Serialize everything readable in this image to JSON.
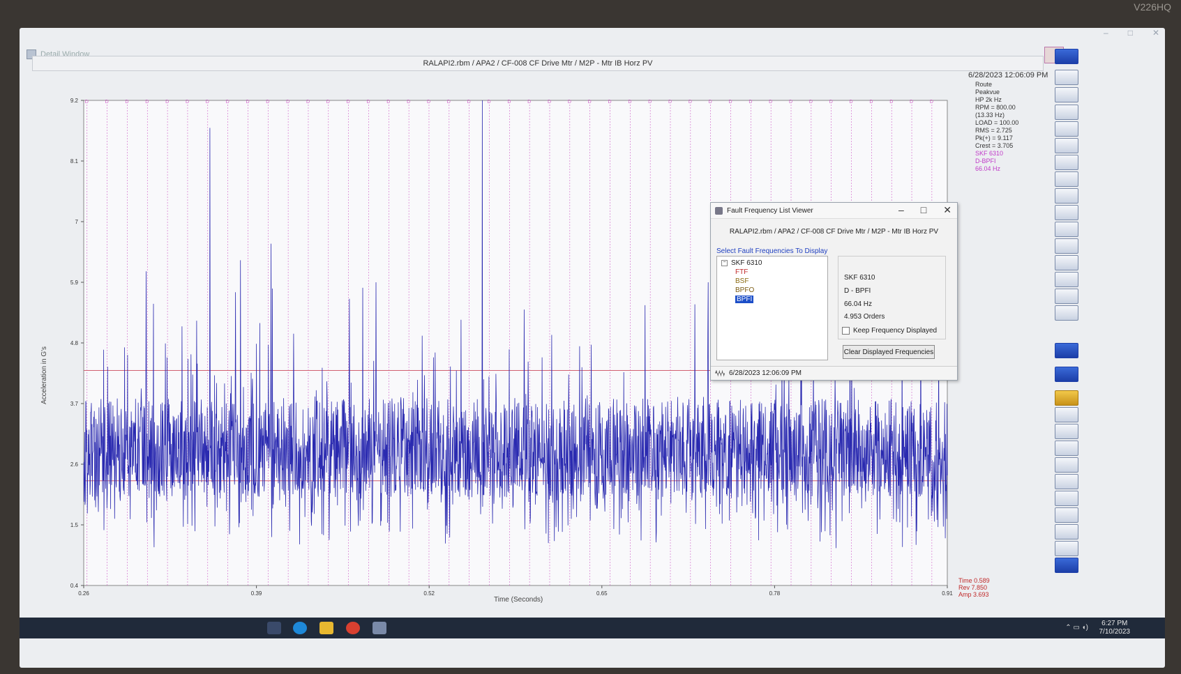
{
  "monitor_label": "V226HQ",
  "window": {
    "title": "Detail Window",
    "path": "RALAPI2.rbm / APA2 / CF-008 CF Drive Mtr / M2P - Mtr IB Horz PV",
    "datetime": "6/28/2023 12:06:09 PM"
  },
  "info": [
    "Route",
    "Peakvue",
    "HP 2k Hz",
    "RPM = 800.00",
    "(13.33 Hz)",
    "LOAD = 100.00",
    "RMS = 2.725",
    "Pk(+) = 9.117",
    "Crest = 3.705"
  ],
  "info_fault": [
    "SKF 6310",
    "D-BPFI",
    "66.04 Hz"
  ],
  "readout": [
    "Time 0.589",
    "Rev 7.850",
    "Amp 3.693"
  ],
  "chart_data": {
    "type": "line",
    "xlabel": "Time (Seconds)",
    "ylabel": "Acceleration in G's",
    "xlim": [
      0.26,
      0.91
    ],
    "ylim": [
      0.4,
      9.2
    ],
    "x_ticks": [
      0.26,
      0.39,
      0.52,
      0.65,
      0.78,
      0.91
    ],
    "y_ticks": [
      0.4,
      1.5,
      2.6,
      3.7,
      4.8,
      5.9,
      7,
      8.1,
      9.2
    ],
    "marker_label": "D",
    "bpfi_interval_s": 0.01514,
    "reference_lines": [
      4.3,
      2.3
    ],
    "peaks": [
      {
        "x": 0.307,
        "y": 6.1
      },
      {
        "x": 0.334,
        "y": 5.1
      },
      {
        "x": 0.355,
        "y": 8.7
      },
      {
        "x": 0.378,
        "y": 6.3
      },
      {
        "x": 0.401,
        "y": 6.6
      },
      {
        "x": 0.46,
        "y": 5.6
      },
      {
        "x": 0.47,
        "y": 5.8
      },
      {
        "x": 0.48,
        "y": 5.9
      },
      {
        "x": 0.56,
        "y": 9.2
      },
      {
        "x": 0.72,
        "y": 5.5
      },
      {
        "x": 0.73,
        "y": 5.9
      },
      {
        "x": 0.89,
        "y": 5.7
      }
    ]
  },
  "dialog": {
    "title": "Fault Frequency List Viewer",
    "path": "RALAPI2.rbm / APA2 / CF-008 CF Drive Mtr / M2P - Mtr IB Horz PV",
    "select_label": "Select Fault Frequencies To Display",
    "tree_root": "SKF 6310",
    "tree_items": [
      "FTF",
      "BSF",
      "BPFO",
      "BPFI"
    ],
    "selected_item": "BPFI",
    "detail": [
      "SKF 6310",
      "D - BPFI",
      "66.04 Hz",
      "4.953 Orders"
    ],
    "keep_label": "Keep Frequency Displayed",
    "keep_checked": false,
    "clear_label": "Clear Displayed Frequencies",
    "status": "6/28/2023 12:06:09 PM"
  },
  "taskbar": {
    "time": "6:27 PM",
    "date": "7/10/2023"
  },
  "colors": {
    "trace": "#2a2ab0",
    "fault_marker": "#d060c8",
    "reference": "#d06070"
  }
}
